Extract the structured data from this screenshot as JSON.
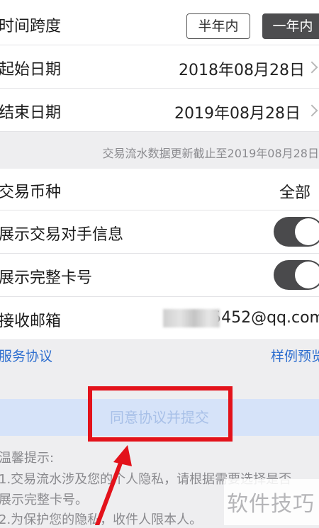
{
  "time_span": {
    "label": "时间跨度",
    "options": [
      "半年内",
      "一年内"
    ],
    "selected": "一年内"
  },
  "start_date": {
    "label": "起始日期",
    "value": "2018年08月28日"
  },
  "end_date": {
    "label": "结束日期",
    "value": "2019年08月28日"
  },
  "update_note": "交易流水数据更新截止至2019年08月28日",
  "currency": {
    "label": "交易币种",
    "value": "全部"
  },
  "show_counterparty": {
    "label": "展示交易对手信息",
    "state": "on"
  },
  "show_full_card": {
    "label": "展示完整卡号",
    "state": "on"
  },
  "email": {
    "label": "接收邮箱",
    "value": "5452@qq.com"
  },
  "links": {
    "service_agreement": "服务协议",
    "sample_preview": "样例预览"
  },
  "submit_label": "同意协议并提交",
  "tips": {
    "title": "温馨提示:",
    "line1": "1.交易流水涉及您的个人隐私，请根据需要选择是否",
    "line2": "展示完整卡号。",
    "line3": "2.为保护您的隐私，收件人限本人。"
  },
  "watermark": "软件技巧",
  "colors": {
    "link_blue": "#2f6fcf",
    "toggle_on": "#4a4a4c",
    "highlight_red": "#e3121b",
    "submit_bg": "#d6e3f9"
  },
  "icons": [
    "chevron-right-icon",
    "arrow-pointer-icon"
  ]
}
